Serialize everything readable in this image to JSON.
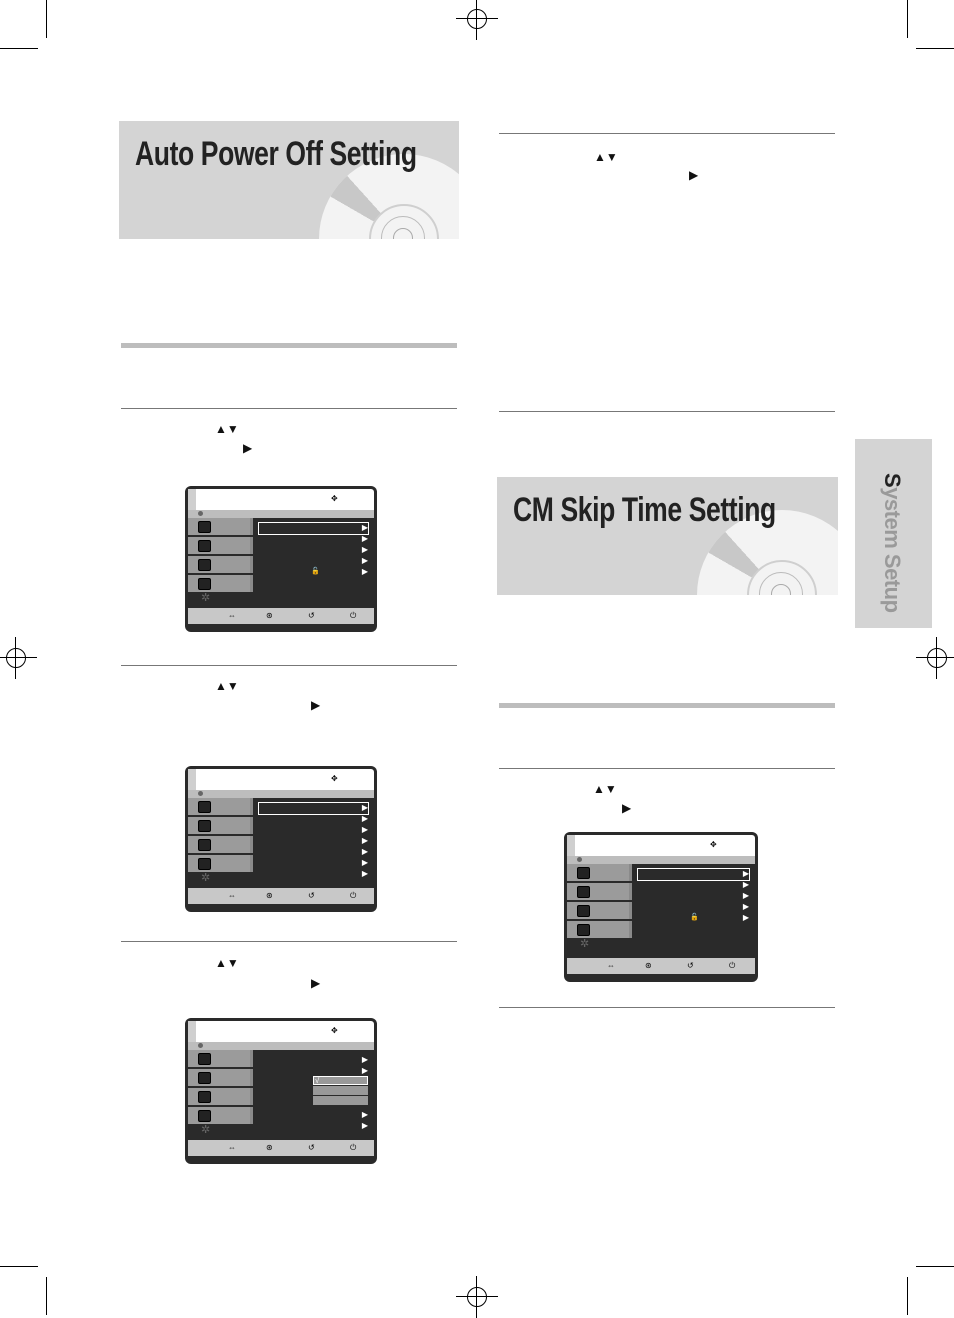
{
  "page": {
    "side_tab": {
      "label_first": "S",
      "label_rest": "ystem Setup"
    },
    "sections": [
      {
        "title": "Auto Power Off Setting"
      },
      {
        "title": "CM Skip Time Setting"
      }
    ]
  },
  "glyphs": {
    "up_down": "▲▼",
    "right": "▶"
  },
  "osd": {
    "nav_icon": "✥",
    "gear_icon": "✲",
    "lock_icon": "🔓",
    "check": "√",
    "arrow": "▶",
    "footer_icons": [
      "⇔",
      "⊛",
      "↺",
      "⏻"
    ]
  }
}
